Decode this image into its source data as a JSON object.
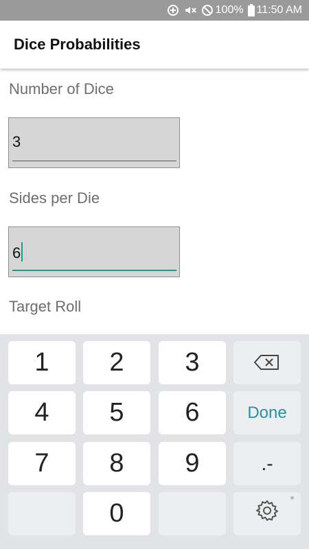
{
  "status_bar": {
    "icons": [
      "data-saver-icon",
      "mute-vibrate-icon",
      "do-not-disturb-icon",
      "battery-icon"
    ],
    "battery": "100%",
    "time": "11:50 AM"
  },
  "app_bar": {
    "title": "Dice Probabilities"
  },
  "form": {
    "dice_label": "Number of Dice",
    "dice_value": "3",
    "sides_label": "Sides per Die",
    "sides_value": "6",
    "target_label": "Target Roll"
  },
  "keyboard": {
    "keys": [
      "1",
      "2",
      "3",
      "4",
      "5",
      "6",
      "7",
      "8",
      "9",
      "0"
    ],
    "done_label": "Done",
    "symbol_key": ".-",
    "icons": [
      "backspace-icon",
      "settings-gear-icon"
    ]
  },
  "colors": {
    "accent": "#1a9a8c",
    "done": "#2a8fa6",
    "status_bar": "#9a9a9a"
  }
}
